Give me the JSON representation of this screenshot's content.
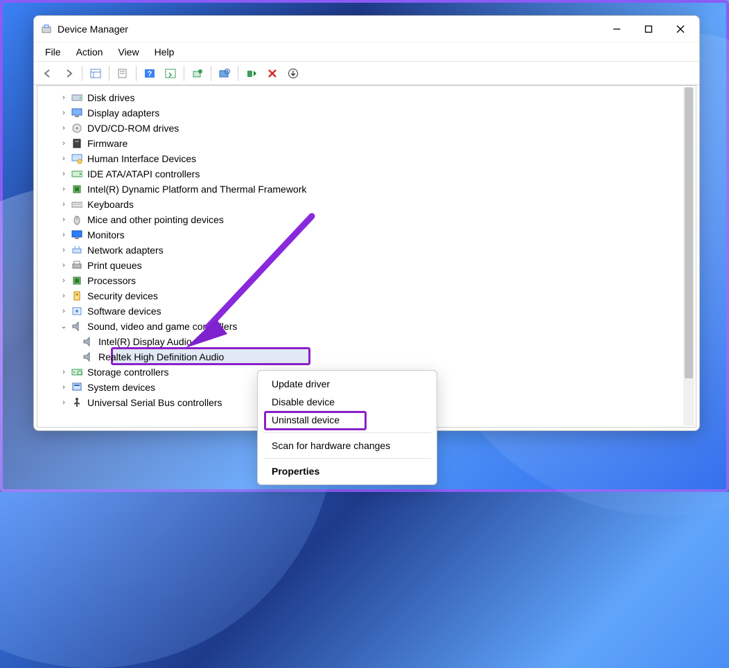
{
  "window": {
    "title": "Device Manager"
  },
  "menubar": [
    "File",
    "Action",
    "View",
    "Help"
  ],
  "tree": {
    "items": [
      {
        "label": "Disk drives",
        "icon": "disk"
      },
      {
        "label": "Display adapters",
        "icon": "display"
      },
      {
        "label": "DVD/CD-ROM drives",
        "icon": "cdrom"
      },
      {
        "label": "Firmware",
        "icon": "firmware"
      },
      {
        "label": "Human Interface Devices",
        "icon": "hid"
      },
      {
        "label": "IDE ATA/ATAPI controllers",
        "icon": "ide"
      },
      {
        "label": "Intel(R) Dynamic Platform and Thermal Framework",
        "icon": "processor"
      },
      {
        "label": "Keyboards",
        "icon": "keyboard"
      },
      {
        "label": "Mice and other pointing devices",
        "icon": "mouse"
      },
      {
        "label": "Monitors",
        "icon": "monitor"
      },
      {
        "label": "Network adapters",
        "icon": "network"
      },
      {
        "label": "Print queues",
        "icon": "printer"
      },
      {
        "label": "Processors",
        "icon": "processor"
      },
      {
        "label": "Security devices",
        "icon": "security"
      },
      {
        "label": "Software devices",
        "icon": "software"
      },
      {
        "label": "Sound, video and game controllers",
        "icon": "sound",
        "expanded": true,
        "children": [
          {
            "label": "Intel(R) Display Audio",
            "icon": "sound"
          },
          {
            "label": "Realtek High Definition Audio",
            "icon": "sound",
            "selected": true
          }
        ]
      },
      {
        "label": "Storage controllers",
        "icon": "storage"
      },
      {
        "label": "System devices",
        "icon": "system"
      },
      {
        "label": "Universal Serial Bus controllers",
        "icon": "usb"
      }
    ]
  },
  "context_menu": {
    "items": [
      {
        "label": "Update driver"
      },
      {
        "label": "Disable device"
      },
      {
        "label": "Uninstall device",
        "highlighted": true
      },
      {
        "separator": true
      },
      {
        "label": "Scan for hardware changes"
      },
      {
        "separator": true
      },
      {
        "label": "Properties",
        "bold": true
      }
    ]
  }
}
